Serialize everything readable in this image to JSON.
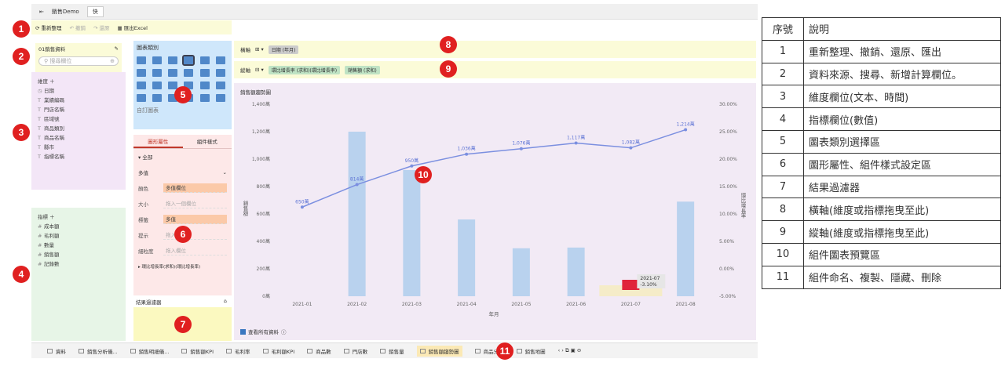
{
  "topbar": {
    "tab_name": "銷售Demo",
    "tab_extra": "快"
  },
  "toolbar": {
    "refresh": "重新整理",
    "undo": "撤銷",
    "redo": "還原",
    "export": "匯出Excel"
  },
  "datasource": {
    "name": "01銷售資料",
    "search_placeholder": "搜尋欄位"
  },
  "dimensions": {
    "title": "維度 ＋",
    "items": [
      {
        "icon": "◷",
        "label": "日期"
      },
      {
        "icon": "T",
        "label": "業績編碼"
      },
      {
        "icon": "T",
        "label": "門店名稱"
      },
      {
        "icon": "T",
        "label": "區域號"
      },
      {
        "icon": "T",
        "label": "商品類別"
      },
      {
        "icon": "T",
        "label": "商品名稱"
      },
      {
        "icon": "T",
        "label": "縣市"
      },
      {
        "icon": "T",
        "label": "指標名稱"
      }
    ]
  },
  "measures": {
    "title": "指標 ＋",
    "items": [
      {
        "icon": "#",
        "label": "成本額"
      },
      {
        "icon": "#",
        "label": "毛利額"
      },
      {
        "icon": "#",
        "label": "數量"
      },
      {
        "icon": "#",
        "label": "銷售額"
      },
      {
        "icon": "#",
        "label": "記錄數"
      }
    ]
  },
  "chart_types": {
    "title": "圖表類別",
    "custom": "自訂圖表"
  },
  "props": {
    "tab_graph": "圖形屬性",
    "tab_style": "組件樣式",
    "all": "▾ 全部",
    "dropdown": "多值",
    "rows": [
      {
        "label": "顏色",
        "value": "多值欄位",
        "on": true
      },
      {
        "label": "大小",
        "value": "拖入一個欄位",
        "on": false
      },
      {
        "label": "標籤",
        "value": "多值",
        "on": true
      },
      {
        "label": "提示",
        "value": "拖入欄位",
        "on": false
      },
      {
        "label": "細粒度",
        "value": "拖入欄位",
        "on": false
      }
    ],
    "footer": "▸ 環比增長率(求和)(環比增長率)"
  },
  "filter": {
    "label": "結果過濾器"
  },
  "axes": {
    "x_label": "橫軸",
    "x_chip": "日期",
    "x_chip_sub": "(年月)",
    "y_label": "縱軸",
    "y_chip1": "環比增長率",
    "y_chip1_sub": "(求和)(環比增長率)",
    "y_chip2": "銷售額",
    "y_chip2_sub": "(求和)"
  },
  "chart_title": "銷售額趨勢圖",
  "chart_data": {
    "type": "bar",
    "categories": [
      "2021-01",
      "2021-02",
      "2021-03",
      "2021-04",
      "2021-05",
      "2021-06",
      "2021-07",
      "2021-08"
    ],
    "xlabel": "年月",
    "ylabel": "銷售額",
    "ylabel_right": "環比增長率",
    "ylim": [
      0,
      1400
    ],
    "ylim_right": [
      -5,
      30
    ],
    "yticks": [
      "0萬",
      "200萬",
      "400萬",
      "600萬",
      "800萬",
      "1,000萬",
      "1,200萬",
      "1,400萬"
    ],
    "yticks_right": [
      "-5.00%",
      "0.00%",
      "5.00%",
      "10.00%",
      "15.00%",
      "20.00%",
      "25.00%",
      "30.00%"
    ],
    "bar_values": [
      0,
      1200,
      920,
      560,
      350,
      355,
      0,
      690
    ],
    "line_values": [
      650,
      814,
      950,
      1036,
      1076,
      1117,
      1082,
      1214
    ],
    "line_labels": [
      "650萬",
      "814萬",
      "950萬",
      "1,036萬",
      "1,076萬",
      "1,117萬",
      "1,082萬",
      "1,214萬"
    ],
    "tooltip": [
      "2021-07",
      "-3.10%"
    ]
  },
  "show_all": "查看所有資料",
  "bottom_tabs": [
    "資料",
    "銷售分析儀...",
    "銷售明細儀...",
    "銷售額KPI",
    "毛利率",
    "毛利額KPI",
    "商品數",
    "門店數",
    "銷售量",
    "銷售額趨勢圖",
    "商品分析",
    "銷售地圖"
  ],
  "legend": {
    "header": [
      "序號",
      "說明"
    ],
    "rows": [
      [
        "1",
        "重新整理、撤銷、還原、匯出"
      ],
      [
        "2",
        "資料來源、搜尋、新增計算欄位。"
      ],
      [
        "3",
        "維度欄位(文本、時間)"
      ],
      [
        "4",
        "指標欄位(數值)"
      ],
      [
        "5",
        "圖表類別選擇區"
      ],
      [
        "6",
        "圖形屬性、組件樣式設定區"
      ],
      [
        "7",
        "結果過濾器"
      ],
      [
        "8",
        "橫軸(維度或指標拖曳至此)"
      ],
      [
        "9",
        "縱軸(維度或指標拖曳至此)"
      ],
      [
        "10",
        "組件圖表預覽區"
      ],
      [
        "11",
        "組件命名、複製、隱藏、刪除"
      ]
    ]
  },
  "badges": [
    "1",
    "2",
    "3",
    "4",
    "5",
    "6",
    "7",
    "8",
    "9",
    "10",
    "11"
  ]
}
